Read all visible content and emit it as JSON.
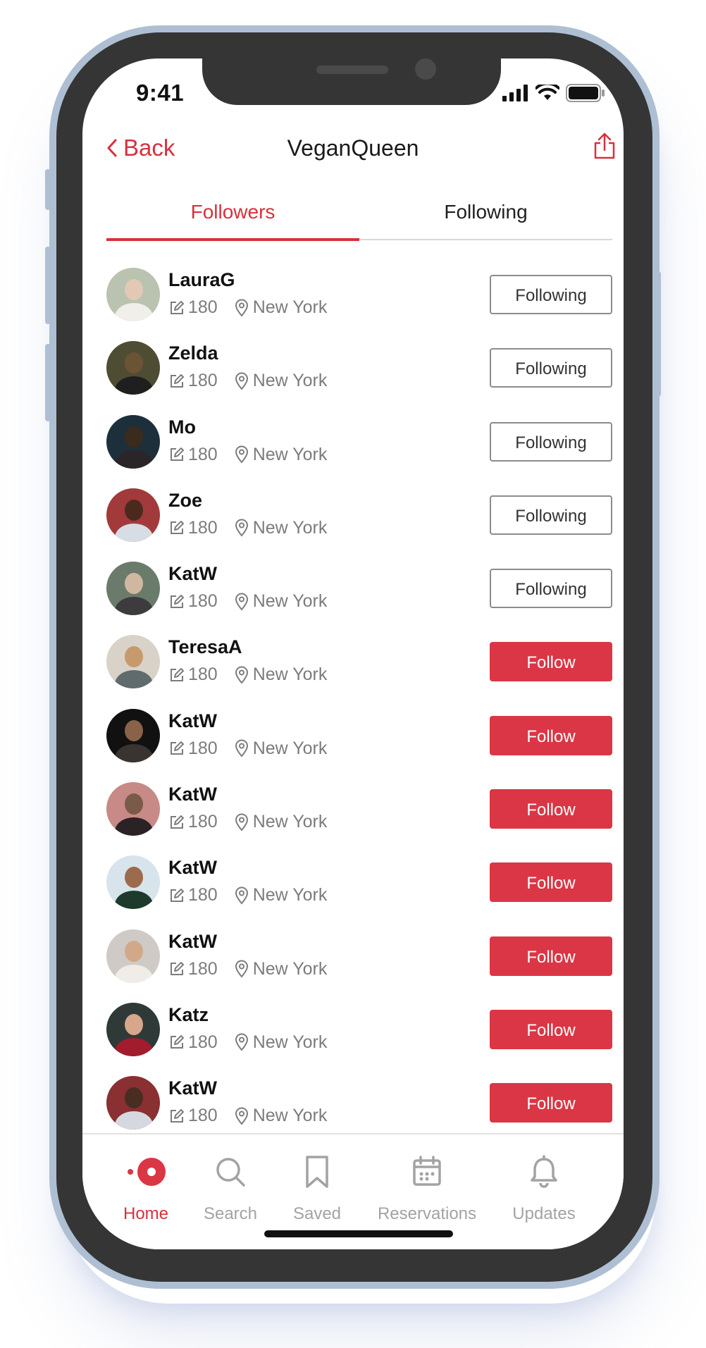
{
  "status_bar": {
    "time": "9:41"
  },
  "nav": {
    "back_label": "Back",
    "title": "VeganQueen"
  },
  "tabs": [
    {
      "label": "Followers",
      "active": true
    },
    {
      "label": "Following",
      "active": false
    }
  ],
  "users": [
    {
      "name": "LauraG",
      "count": "180",
      "location": "New York",
      "button": "Following",
      "state": "following"
    },
    {
      "name": "Zelda",
      "count": "180",
      "location": "New York",
      "button": "Following",
      "state": "following"
    },
    {
      "name": "Mo",
      "count": "180",
      "location": "New York",
      "button": "Following",
      "state": "following"
    },
    {
      "name": "Zoe",
      "count": "180",
      "location": "New York",
      "button": "Following",
      "state": "following"
    },
    {
      "name": "KatW",
      "count": "180",
      "location": "New York",
      "button": "Following",
      "state": "following"
    },
    {
      "name": "TeresaA",
      "count": "180",
      "location": "New York",
      "button": "Follow",
      "state": "follow"
    },
    {
      "name": "KatW",
      "count": "180",
      "location": "New York",
      "button": "Follow",
      "state": "follow"
    },
    {
      "name": "KatW",
      "count": "180",
      "location": "New York",
      "button": "Follow",
      "state": "follow"
    },
    {
      "name": "KatW",
      "count": "180",
      "location": "New York",
      "button": "Follow",
      "state": "follow"
    },
    {
      "name": "KatW",
      "count": "180",
      "location": "New York",
      "button": "Follow",
      "state": "follow"
    },
    {
      "name": "Katz",
      "count": "180",
      "location": "New York",
      "button": "Follow",
      "state": "follow"
    },
    {
      "name": "KatW",
      "count": "180",
      "location": "New York",
      "button": "Follow",
      "state": "follow"
    }
  ],
  "tab_bar": [
    {
      "label": "Home",
      "icon": "home-icon",
      "active": true
    },
    {
      "label": "Search",
      "icon": "search-icon",
      "active": false
    },
    {
      "label": "Saved",
      "icon": "bookmark-icon",
      "active": false
    },
    {
      "label": "Reservations",
      "icon": "calendar-icon",
      "active": false
    },
    {
      "label": "Updates",
      "icon": "bell-icon",
      "active": false
    }
  ],
  "colors": {
    "accent": "#db3645",
    "muted": "#7c7c7c",
    "inactive": "#a3a3a3"
  }
}
